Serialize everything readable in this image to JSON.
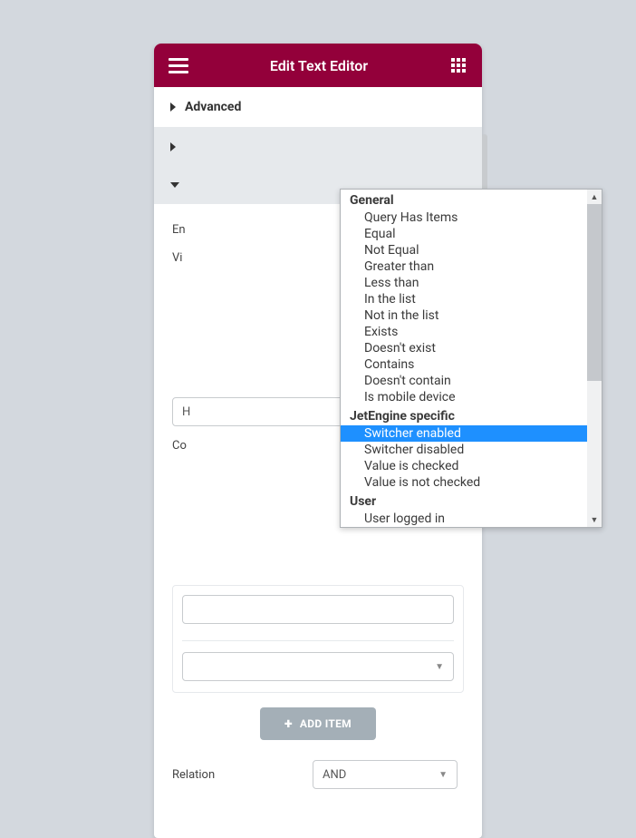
{
  "header": {
    "title": "Edit Text Editor"
  },
  "sections": {
    "advanced": "Advanced",
    "en_label_trunc": "En",
    "vi_label_trunc": "Vi",
    "visibility_value_trunc": "H",
    "co_label_trunc": "Co"
  },
  "add_item": "ADD ITEM",
  "relation": {
    "label": "Relation",
    "value": "AND"
  },
  "dropdown": {
    "groups": [
      {
        "label": "General",
        "options": [
          "Query Has Items",
          "Equal",
          "Not Equal",
          "Greater than",
          "Less than",
          "In the list",
          "Not in the list",
          "Exists",
          "Doesn't exist",
          "Contains",
          "Doesn't contain",
          "Is mobile device"
        ]
      },
      {
        "label": "JetEngine specific",
        "options": [
          "Switcher enabled",
          "Switcher disabled",
          "Value is checked",
          "Value is not checked"
        ]
      },
      {
        "label": "User",
        "options": [
          "User logged in"
        ]
      }
    ],
    "selected": "Switcher enabled"
  }
}
